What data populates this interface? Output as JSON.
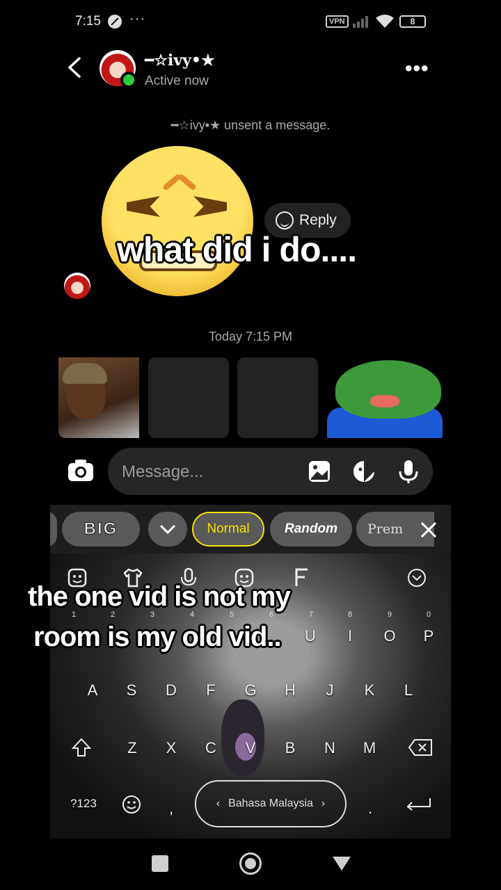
{
  "status_bar": {
    "time": "7:15",
    "extra": "···",
    "vpn": "VPN",
    "battery": "8"
  },
  "header": {
    "username": "━☆ivy•★",
    "status": "Active now"
  },
  "chat": {
    "unsent_notice": "━☆ivy•★ unsent a message.",
    "reply_label": "Reply",
    "timestamp": "Today 7:15 PM",
    "overlay_caption": "what did i do...."
  },
  "composer": {
    "placeholder": "Message..."
  },
  "keyboard": {
    "toolbar": {
      "big": "BIG",
      "normal": "Normal",
      "random": "Random",
      "premium": "Prem"
    },
    "numbers": [
      "1",
      "2",
      "3",
      "4",
      "5",
      "6",
      "7",
      "8",
      "9",
      "0"
    ],
    "row1_visible": [
      "U",
      "I",
      "O",
      "P"
    ],
    "row2": [
      "A",
      "S",
      "D",
      "F",
      "G",
      "H",
      "J",
      "K",
      "L"
    ],
    "row3": [
      "Z",
      "X",
      "C",
      "V",
      "B",
      "N",
      "M"
    ],
    "symbols_key": "?123",
    "comma": ",",
    "period": ".",
    "language": "Bahasa Malaysia",
    "overlay_caption_line1": "the one vid is not my",
    "overlay_caption_line2": "room is my old vid.."
  },
  "colors": {
    "accent_yellow": "#f5e100",
    "online_green": "#2ecc40"
  }
}
